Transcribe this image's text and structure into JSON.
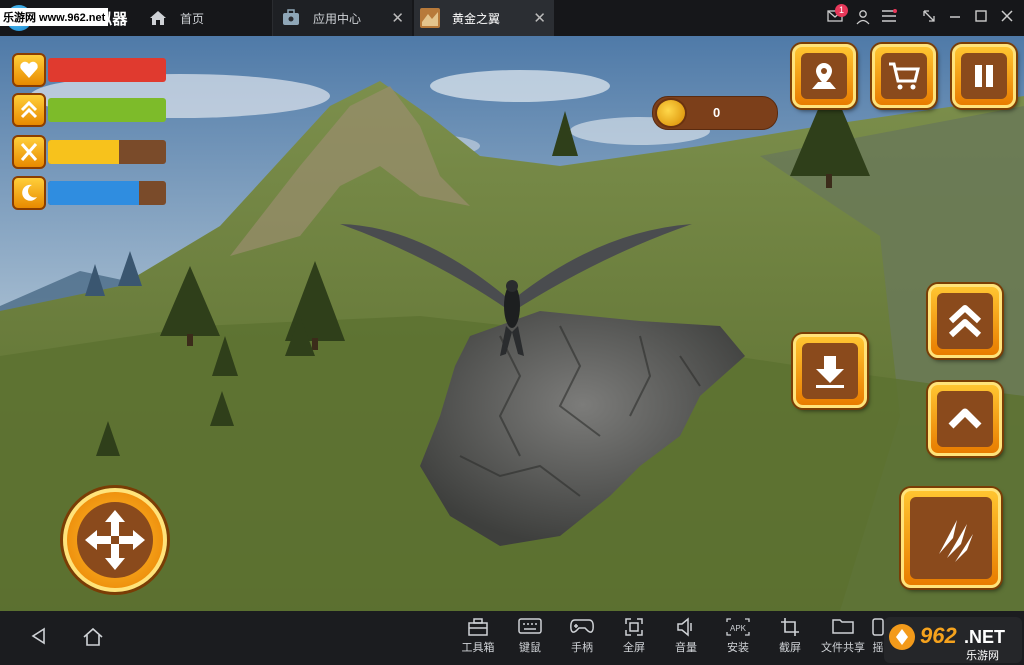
{
  "window": {
    "app_name": "MuMu模拟器",
    "watermark": "乐游网 www.962.net",
    "tabs": [
      {
        "label": "首页",
        "icon": "home-icon"
      },
      {
        "label": "应用中心",
        "icon": "app-center-icon"
      },
      {
        "label": "黄金之翼",
        "icon": "game-thumbnail-icon"
      }
    ],
    "mail_badge": "1",
    "controls": [
      "mail-icon",
      "user-icon",
      "menu-icon",
      "shrink-icon",
      "minimize-icon",
      "maximize-icon",
      "close-icon"
    ]
  },
  "hud": {
    "stats": [
      {
        "name": "health",
        "icon": "heart-icon",
        "level": 1.0,
        "color": "#e03a2f"
      },
      {
        "name": "level",
        "icon": "double-chevron-icon",
        "level": 1.0,
        "color": "#7dbb2a"
      },
      {
        "name": "food",
        "icon": "fork-knife-icon",
        "level": 0.6,
        "color": "#f7c21c"
      },
      {
        "name": "energy",
        "icon": "moon-icon",
        "level": 0.77,
        "color": "#2f8de0"
      }
    ],
    "coins": "0",
    "top_buttons": [
      "map-pin-icon",
      "shopping-cart-icon",
      "pause-icon"
    ],
    "right_buttons": [
      "land-down-icon",
      "double-up-icon",
      "up-icon",
      "claw-attack-icon"
    ],
    "move_button": "move-arrows-icon"
  },
  "taskbar": {
    "nav": [
      "back-icon",
      "home-icon"
    ],
    "tools": [
      {
        "label": "工具箱",
        "icon": "toolbox-icon"
      },
      {
        "label": "键鼠",
        "icon": "keyboard-icon"
      },
      {
        "label": "手柄",
        "icon": "gamepad-icon"
      },
      {
        "label": "全屏",
        "icon": "fullscreen-icon"
      },
      {
        "label": "音量",
        "icon": "volume-icon"
      },
      {
        "label": "安装",
        "icon": "apk-install-icon"
      },
      {
        "label": "截屏",
        "icon": "crop-icon"
      },
      {
        "label": "文件共享",
        "icon": "folder-icon"
      },
      {
        "label": "摇",
        "icon": "shake-icon"
      }
    ],
    "brand_logo": {
      "text": "962.NET",
      "subtitle": "乐游网"
    }
  }
}
